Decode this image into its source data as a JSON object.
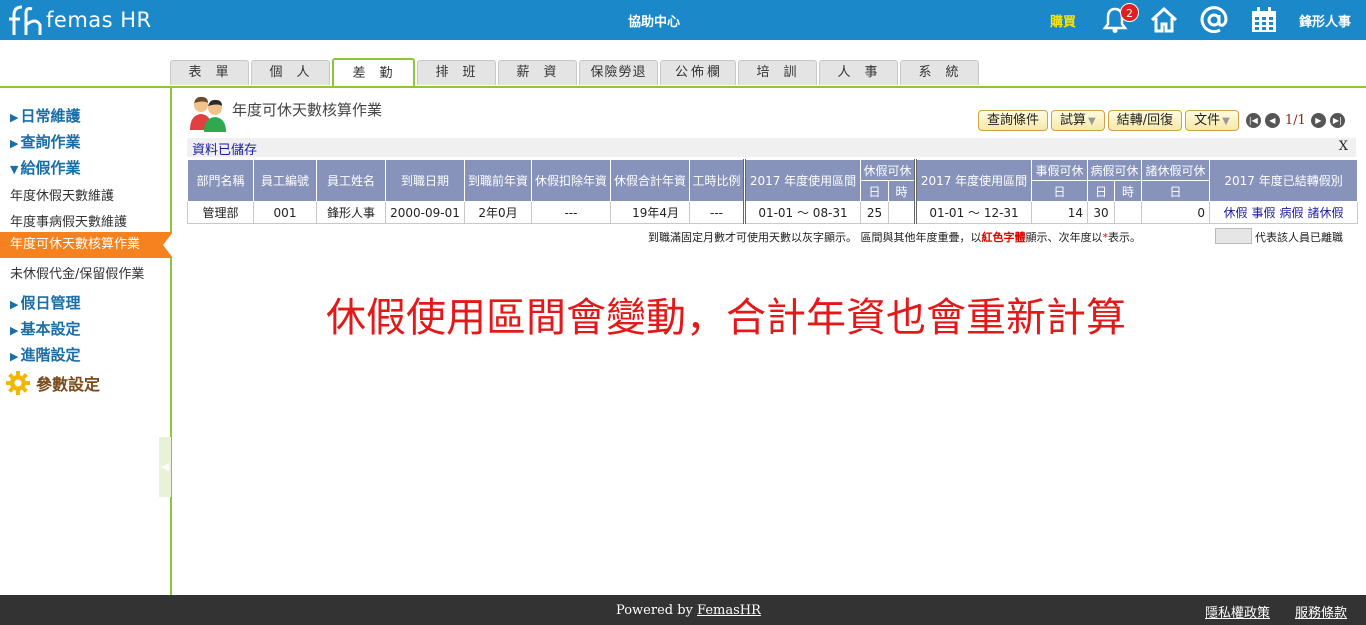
{
  "header": {
    "logo_text": "femas HR",
    "help_center": "協助中心",
    "buy": "購買",
    "notification_count": "2",
    "user_name": "鋒形人事",
    "colors": {
      "bar": "#1a88c9",
      "buy": "#ffe000",
      "badge": "#e02020"
    }
  },
  "tabs": [
    {
      "label": "表單"
    },
    {
      "label": "個人"
    },
    {
      "label": "差勤",
      "active": true
    },
    {
      "label": "排班"
    },
    {
      "label": "薪資"
    },
    {
      "label": "保險勞退"
    },
    {
      "label": "公佈欄"
    },
    {
      "label": "培訓"
    },
    {
      "label": "人事"
    },
    {
      "label": "系統"
    }
  ],
  "sidebar": {
    "groups": {
      "daily": "日常維護",
      "query": "查詢作業",
      "leave": "給假作業",
      "holiday": "假日管理",
      "basic": "基本設定",
      "advanced": "進階設定"
    },
    "items": {
      "annual_leave_maint": "年度休假天數維護",
      "personal_sick_maint": "年度事病假天數維護",
      "annual_calc": "年度可休天數核算作業",
      "unused_leave_pay": "未休假代金/保留假作業"
    },
    "param_setting": "參數設定",
    "arrows": {
      "expanded": "▼",
      "collapsed": "▶"
    },
    "active_color": "#f5821f"
  },
  "page": {
    "title": "年度可休天數核算作業",
    "toolbar": {
      "query_conditions": "查詢條件",
      "trial_calc": "試算",
      "carry_over": "結轉/回復",
      "document": "文件"
    },
    "pager": "1/1",
    "saved_message": "資料已儲存",
    "close": "X"
  },
  "table": {
    "headers": {
      "dept": "部門名稱",
      "emp_no": "員工編號",
      "emp_name": "員工姓名",
      "hire_date": "到職日期",
      "prior_seniority": "到職前年資",
      "deduct_seniority": "休假扣除年資",
      "total_seniority": "休假合計年資",
      "work_ratio": "工時比例",
      "period_2017_a": "2017 年度使用區間",
      "annual_leave": "休假可休",
      "day": "日",
      "hour": "時",
      "period_2017_b": "2017 年度使用區間",
      "personal_leave": "事假可休",
      "sick_leave": "病假可休",
      "other_leave": "諸休假可休",
      "carried_types": "2017 年度已結轉假別"
    },
    "row": {
      "dept": "管理部",
      "emp_no": "001",
      "emp_name": "鋒形人事",
      "hire_date": "2000-09-01",
      "prior_seniority": "2年0月",
      "deduct_seniority": "---",
      "total_seniority": "19年4月",
      "work_ratio": "---",
      "period_a": "01-01 ～ 08-31",
      "annual_day": "25",
      "annual_hour": "",
      "period_b": "01-01 ～ 12-31",
      "personal_day": "14",
      "sick_day": "30",
      "sick_hour": "",
      "other_day": "0",
      "carried": [
        "休假",
        "事假",
        "病假",
        "諸休假"
      ]
    },
    "header_color": "#8793bb"
  },
  "notes": {
    "part1": "到職滿固定月數才可使用天數以灰字顯示。 區間與其他年度重疊，以",
    "red_text": "紅色字體",
    "part2": "顯示、次年度以",
    "star": "*",
    "part3": "表示。",
    "legend": "代表該人員已離職"
  },
  "banner": {
    "message": "休假使用區間會變動，合計年資也會重新計算",
    "color": "#e41818"
  },
  "footer": {
    "powered_prefix": "Powered by ",
    "powered_brand": "FemasHR",
    "privacy": "隱私權政策",
    "terms": "服務條款"
  }
}
